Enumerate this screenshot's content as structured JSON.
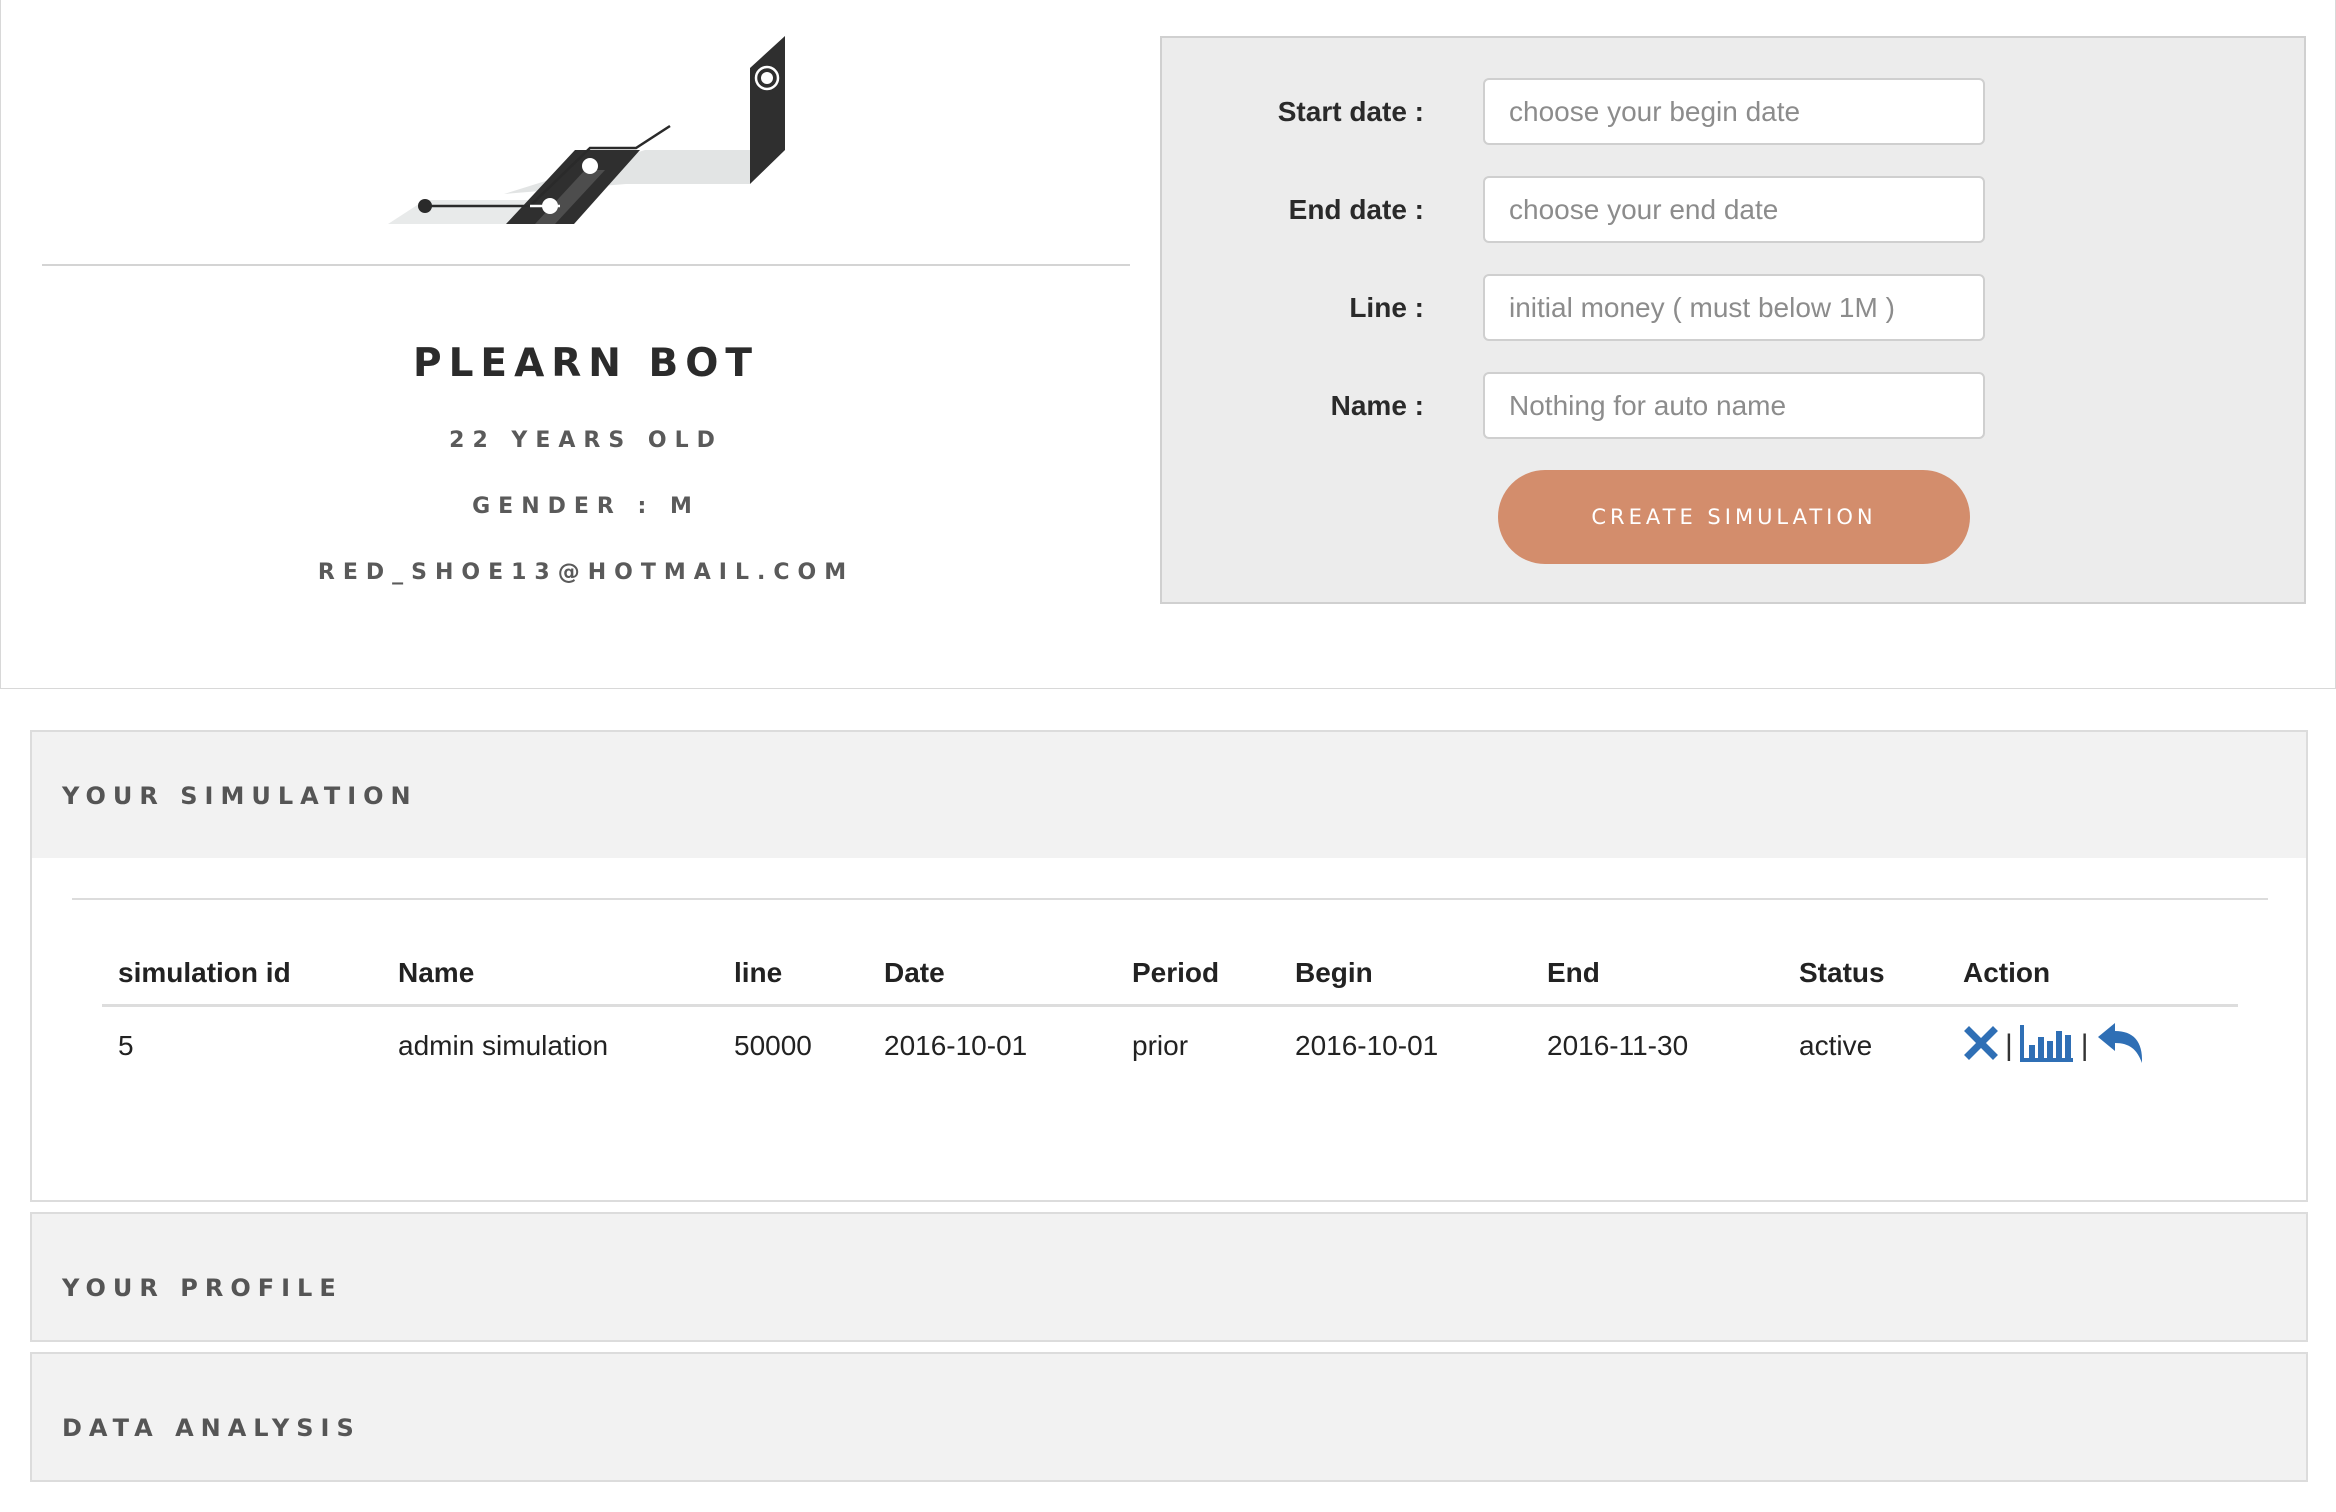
{
  "profile": {
    "name": "PLEARN BOT",
    "age": "22 YEARS OLD",
    "gender": "GENDER : M",
    "email": "RED_SHOE13@HOTMAIL.COM"
  },
  "form": {
    "start_label": "Start date :",
    "start_placeholder": "choose your begin date",
    "end_label": "End date :",
    "end_placeholder": "choose your end date",
    "line_label": "Line :",
    "line_placeholder": "initial money ( must below 1M )",
    "name_label": "Name :",
    "name_placeholder": "Nothing for auto name",
    "submit_label": "CREATE SIMULATION"
  },
  "sections": {
    "simulation": "YOUR SIMULATION",
    "profile": "YOUR PROFILE",
    "data_analysis": "DATA ANALYSIS"
  },
  "table": {
    "headers": [
      "simulation id",
      "Name",
      "line",
      "Date",
      "Period",
      "Begin",
      "End",
      "Status",
      "Action"
    ],
    "rows": [
      [
        "5",
        "admin simulation",
        "50000",
        "2016-10-01",
        "prior",
        "2016-10-01",
        "2016-11-30",
        "active"
      ]
    ]
  },
  "icons": {
    "delete": "close-icon",
    "chart": "bar-chart-icon",
    "back": "reply-icon"
  },
  "colors": {
    "accent_button": "#d38d6c",
    "action_icon": "#2f6fb5",
    "panel_bg": "#ececec",
    "section_bg": "#f2f2f2"
  }
}
